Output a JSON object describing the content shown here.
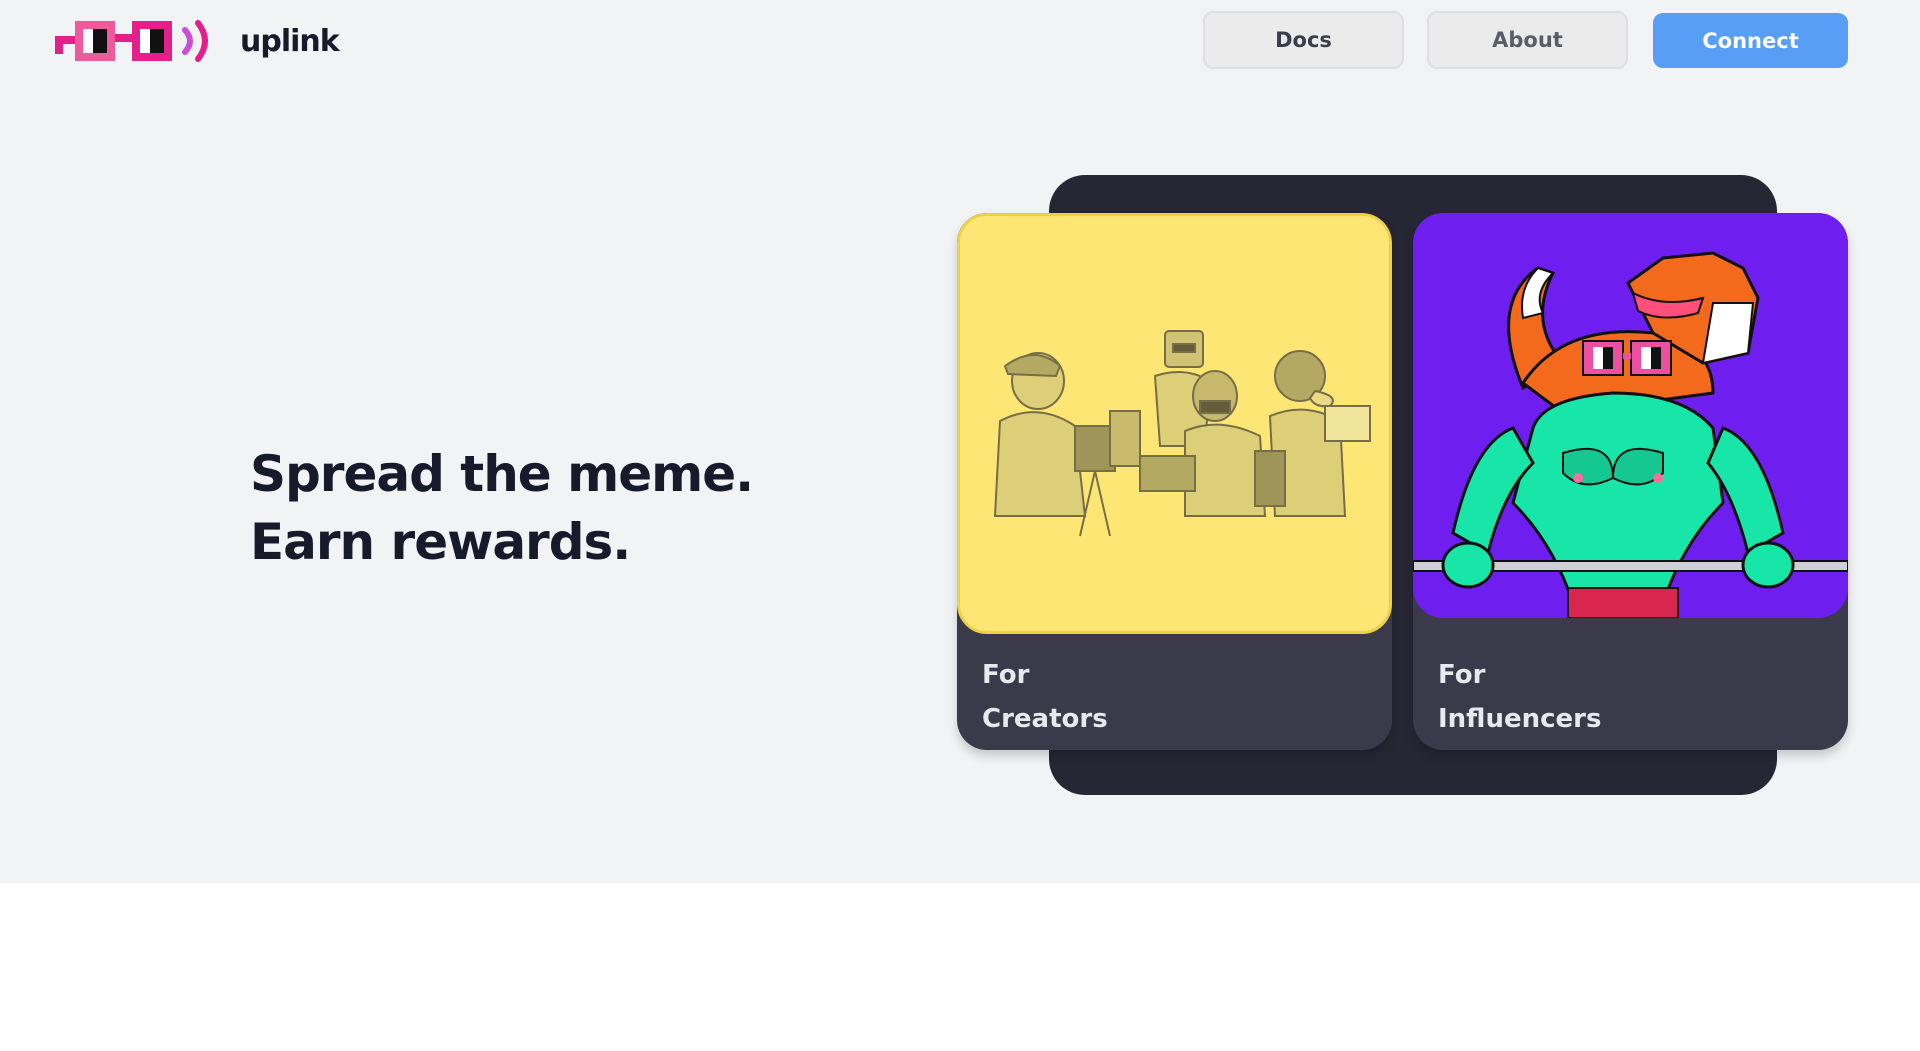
{
  "header": {
    "brand": "uplink",
    "nav": {
      "docs_label": "Docs",
      "about_label": "About",
      "connect_label": "Connect"
    }
  },
  "hero": {
    "headline_line1": "Spread the meme.",
    "headline_line2": "Earn rewards."
  },
  "cards": [
    {
      "label_line1": "For",
      "label_line2": "Creators",
      "icon": "creators-illustration",
      "color": "#fee675"
    },
    {
      "label_line1": "For",
      "label_line2": "Influencers",
      "icon": "influencer-fox-illustration",
      "color": "#6e1ff0"
    }
  ],
  "colors": {
    "accent": "#589df6",
    "brand_pink": "#e51f8a",
    "dark_panel": "#262635",
    "card_bg": "#3a3a4a",
    "hero_bg": "#f2f3f5"
  }
}
